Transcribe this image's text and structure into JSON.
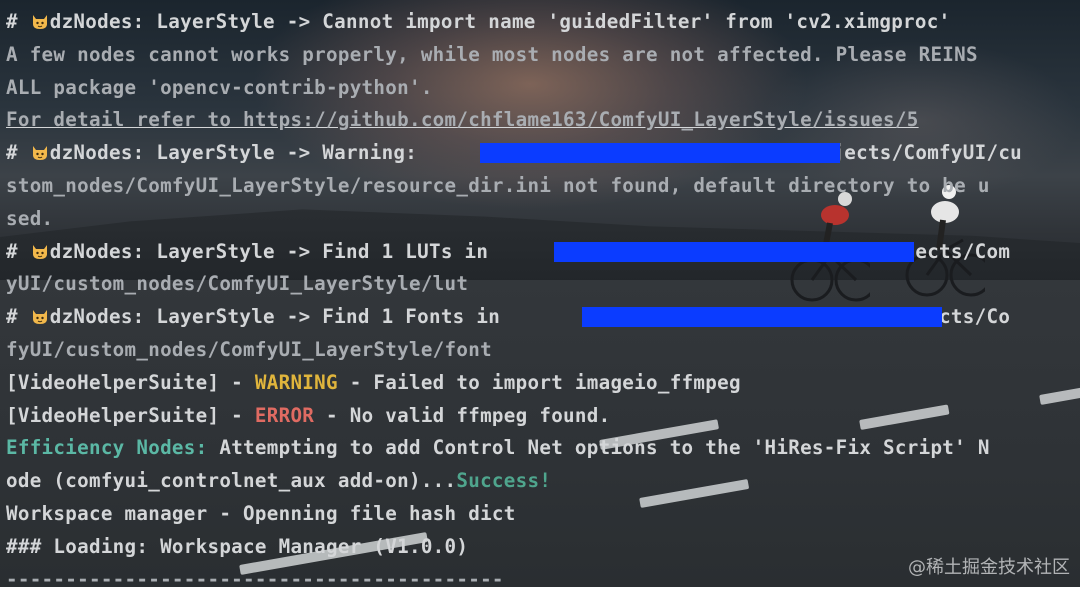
{
  "terminal": {
    "lines": [
      {
        "prefix": "# ",
        "emoji": "cat-face-icon",
        "text": "dzNodes: LayerStyle -> Cannot import name 'guidedFilter' from 'cv2.ximgproc'"
      },
      {
        "text": "A few nodes cannot works properly, while most nodes are not affected. Please REINS"
      },
      {
        "text": "ALL package 'opencv-contrib-python'."
      },
      {
        "text": "For detail refer to https://github.com/chflame163/ComfyUI_LayerStyle/issues/5"
      },
      {
        "prefix": "# ",
        "emoji": "cat-face-icon",
        "text_before": "dzNodes: LayerStyle -> Warning: ",
        "text_after": "/projects/ComfyUI/cu"
      },
      {
        "text": "stom_nodes/ComfyUI_LayerStyle/resource_dir.ini not found, default directory to be u"
      },
      {
        "text": "sed."
      },
      {
        "prefix": "# ",
        "emoji": "cat-face-icon",
        "text_before": "dzNodes: LayerStyle -> Find 1 LUTs in ",
        "text_after": "/projects/Com"
      },
      {
        "text": "yUI/custom_nodes/ComfyUI_LayerStyle/lut"
      },
      {
        "prefix": "# ",
        "emoji": "cat-face-icon",
        "text_before": "dzNodes: LayerStyle -> Find 1 Fonts in ",
        "text_after": "/projects/Co"
      },
      {
        "text": "fyUI/custom_nodes/ComfyUI_LayerStyle/font"
      },
      {
        "text_before": "[VideoHelperSuite] - ",
        "level": "WARNING",
        "text_after": " - Failed to import imageio_ffmpeg"
      },
      {
        "text_before": "[VideoHelperSuite] - ",
        "level": "ERROR",
        "text_after": " - No valid ffmpeg found."
      },
      {
        "label": "Efficiency Nodes:",
        "text": " Attempting to add Control Net options to the 'HiRes-Fix Script' N"
      },
      {
        "text_before": "ode (comfyui_controlnet_aux add-on)...",
        "status": "Success!"
      },
      {
        "text": "Workspace manager - Openning file hash dict"
      },
      {
        "text": "### Loading: Workspace Manager (V1.0.0)"
      },
      {
        "text": "------------------------------------------"
      }
    ]
  },
  "watermark": "@稀土掘金技术社区",
  "colors": {
    "warning": "#e0b53c",
    "error": "#e06b62",
    "label_teal": "#5bb8a5",
    "success": "#4fa58d",
    "redaction": "#0b3cff"
  }
}
